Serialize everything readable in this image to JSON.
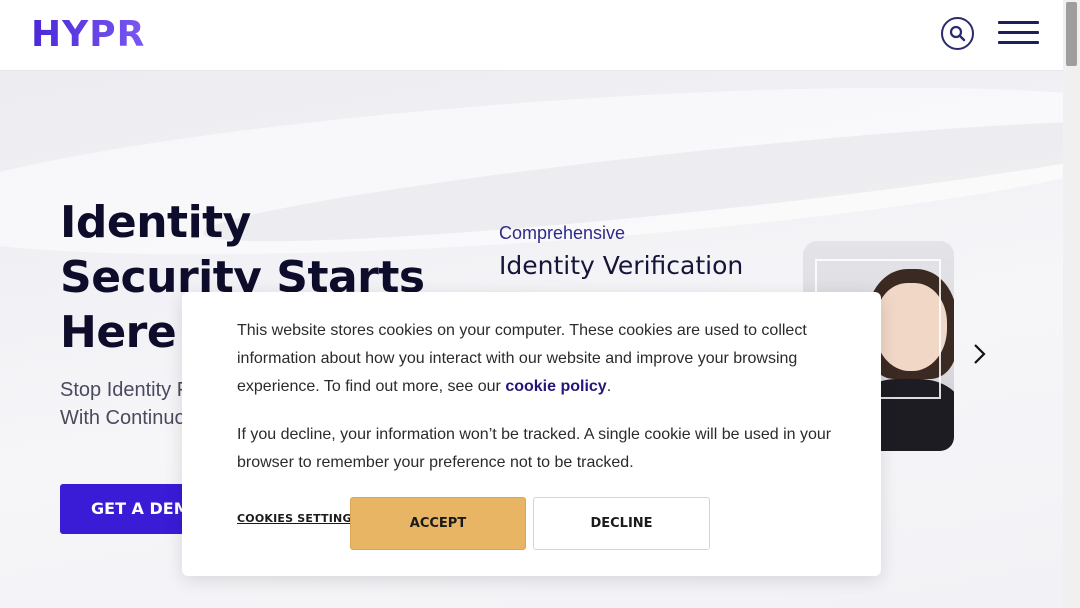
{
  "header": {
    "logo": "HYPR",
    "icons": {
      "search": "search-icon",
      "menu": "hamburger-menu-icon"
    }
  },
  "hero": {
    "title": "Identity Security Starts Here",
    "subtitle": "Stop Identity Fraud. Boost Productivity With Continuous Identity Assurance.",
    "cta_label": "GET A DEMO"
  },
  "slide": {
    "kicker": "Comprehensive",
    "title": "Identity Verification",
    "next_icon": "chevron-right-icon"
  },
  "cookie_banner": {
    "text_before_link": "This website stores cookies on your computer. These cookies are used to collect information about how you interact with our website and improve your browsing experience. To find out more, see our ",
    "link_label": "cookie policy",
    "text_after_link": ".",
    "paragraph_2": "If you decline, your information won’t be tracked. A single cookie will be used in your browser to remember your preference not to be tracked.",
    "settings_label": "COOKIES SETTINGS",
    "accept_label": "ACCEPT",
    "decline_label": "DECLINE"
  },
  "colors": {
    "brand_purple": "#3a1bd6",
    "navy": "#1e1e5a",
    "accept_gold": "#e7b564"
  }
}
